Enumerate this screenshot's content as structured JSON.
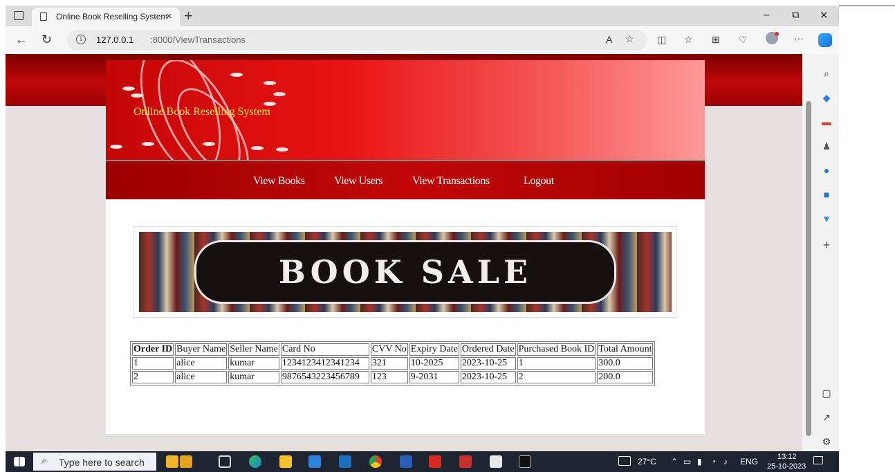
{
  "browser": {
    "tab_title": "Online Book Reselling System",
    "tab_close": "×",
    "new_tab": "+",
    "url_host": "127.0.0.1",
    "url_path": ":8000/ViewTransactions",
    "window_buttons": [
      "–",
      "⧉",
      "✕"
    ]
  },
  "site": {
    "title": "Online Book Reselling System",
    "nav": [
      "View Books",
      "View Users",
      "View Transactions",
      "Logout"
    ],
    "banner_text": "BOOK SALE"
  },
  "table": {
    "headers": [
      "Order ID",
      "Buyer Name",
      "Seller Name",
      "Card No",
      "CVV No",
      "Expiry Date",
      "Ordered Date",
      "Purchased Book ID",
      "Total Amount"
    ],
    "rows": [
      [
        "1",
        "alice",
        "kumar",
        "1234123412341234",
        "321",
        "10-2025",
        "2023-10-25",
        "1",
        "300.0"
      ],
      [
        "2",
        "alice",
        "kumar",
        "9876543223456789",
        "123",
        "9-2031",
        "2023-10-25",
        "2",
        "200.0"
      ]
    ]
  },
  "taskbar": {
    "search_placeholder": "Type here to search",
    "temperature": "27°C",
    "language": "ENG",
    "time": "13:12",
    "date": "25-10-2023"
  },
  "colors": {
    "header_red": "#e81414",
    "nav_red": "#c00707",
    "title_yellow": "#ffe84a"
  }
}
